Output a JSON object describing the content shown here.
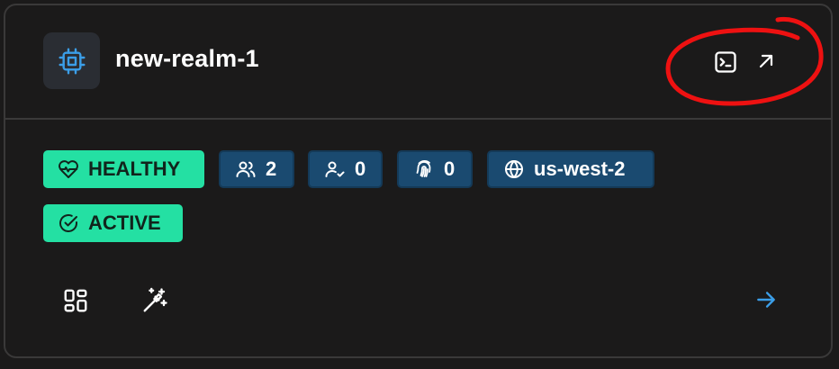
{
  "realm": {
    "name": "new-realm-1",
    "icon": "cpu-chip-icon"
  },
  "header_actions": [
    {
      "name": "terminal-button",
      "icon": "terminal-icon"
    },
    {
      "name": "open-external-button",
      "icon": "arrow-up-right-icon"
    }
  ],
  "badges": {
    "health": {
      "label": "HEALTHY",
      "icon": "heart-pulse-icon"
    },
    "users": {
      "value": "2",
      "icon": "users-icon"
    },
    "verified_users": {
      "value": "0",
      "icon": "user-check-icon"
    },
    "fingerprints": {
      "value": "0",
      "icon": "fingerprint-icon"
    },
    "region": {
      "value": "us-west-2",
      "icon": "globe-icon"
    },
    "status": {
      "label": "ACTIVE",
      "icon": "check-circle-icon"
    }
  },
  "footer_actions": [
    {
      "name": "dashboard-button",
      "icon": "grid-icon"
    },
    {
      "name": "magic-wand-button",
      "icon": "wand-sparkles-icon"
    },
    {
      "name": "navigate-button",
      "icon": "arrow-right-icon"
    }
  ],
  "colors": {
    "background": "#1b1a1a",
    "border": "#3a3939",
    "healthy_green": "#24e0a3",
    "badge_blue": "#1a4a70",
    "accent_blue": "#3b9ee8",
    "annotation_red": "#ee1111"
  }
}
